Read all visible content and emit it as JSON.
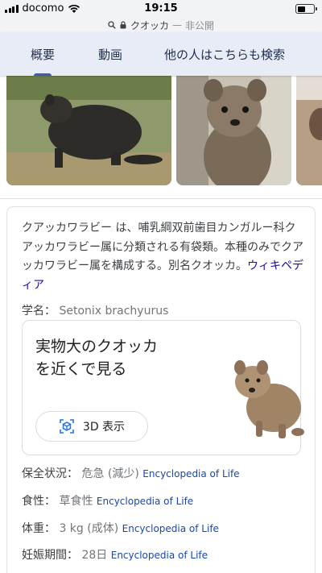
{
  "status_bar": {
    "carrier": "docomo",
    "time": "19:15",
    "battery_level": 0.45
  },
  "url_bar": {
    "query": "クオッカ",
    "separator": " — ",
    "privacy": "非公開"
  },
  "tabs": [
    {
      "label": "概要",
      "active": true
    },
    {
      "label": "動画",
      "active": false
    },
    {
      "label": "他の人はこちらも検索",
      "active": false
    }
  ],
  "knowledge_panel": {
    "description_prefix": "クアッカワラビー",
    "description_body": " は、哺乳綱双前歯目カンガルー科クアッカワラビー属に分類される有袋類。本種のみでクアッカワラビー属を構成する。別名クオッカ。",
    "source_link": "ウィキペディア",
    "scientific_name_label": "学名：",
    "scientific_name_value": "Setonix brachyurus",
    "ar_card": {
      "title": "実物大のクオッカを近くで見る",
      "button_label": "3D 表示"
    },
    "facts": [
      {
        "label": "保全状況：",
        "value": "危急 (減少)",
        "source": "Encyclopedia of Life"
      },
      {
        "label": "食性：",
        "value": "草食性",
        "source": "Encyclopedia of Life"
      },
      {
        "label": "体重：",
        "value": "3 kg (成体)",
        "source": "Encyclopedia of Life"
      },
      {
        "label": "妊娠期間：",
        "value": "28日",
        "source": "Encyclopedia of Life"
      }
    ]
  },
  "colors": {
    "tab_bar_bg": "#e8ecf6",
    "tab_indicator": "#3a5cc0",
    "link": "#1a0dab",
    "source_link": "#1a47a8"
  }
}
